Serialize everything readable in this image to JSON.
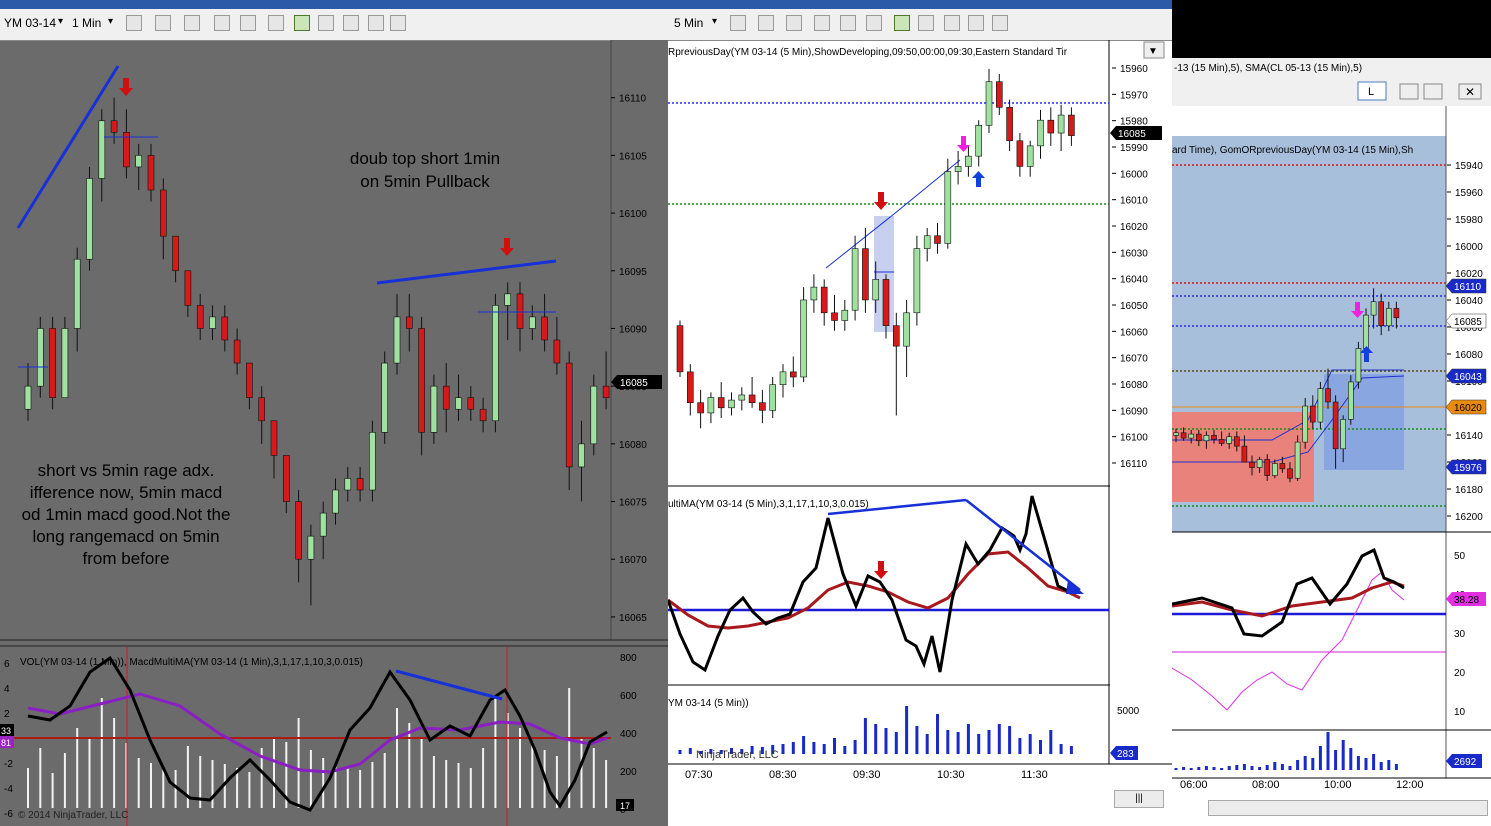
{
  "left_window": {
    "instrument": "YM 03-14",
    "interval": "1 Min",
    "y_ticks": [
      "16110",
      "16105",
      "16100",
      "16095",
      "16090",
      "16085",
      "16080",
      "16075",
      "16070",
      "16065"
    ],
    "last_price": "16085",
    "annotation_top_lines": [
      "doub top short 1min",
      "on 5min Pullback"
    ],
    "annotation_bottom_lines": [
      "short vs  5min rage adx.",
      "ifference now, 5min macd",
      "od 1min macd good.Not the",
      "long rangemacd on 5min",
      "from before"
    ],
    "indicator_label": "VOL(YM 03-14 (1 Min)), MacdMultiMA(YM 03-14 (1 Min),3,1,17,1,10,3,0.015)",
    "vol_ticks": [
      "800",
      "600",
      "400",
      "200",
      "0"
    ],
    "macd_ticks": [
      "6",
      "4",
      "2",
      "0",
      "-2",
      "-4",
      "-6"
    ],
    "marker_top": "33",
    "marker_bottom": "81",
    "vol_marker": "17",
    "copyright": "© 2014 NinjaTrader, LLC"
  },
  "mid_window": {
    "interval": "5 Min",
    "header": "RpreviousDay(YM 03-14 (5 Min),ShowDeveloping,09:50,00:00,09:30,Eastern Standard Tir",
    "y_ticks": [
      "16110",
      "16100",
      "16090",
      "16080",
      "16070",
      "16060",
      "16050",
      "16040",
      "16030",
      "16020",
      "16010",
      "16000",
      "15990",
      "15980",
      "15970",
      "15960"
    ],
    "last_price": "16085",
    "indicator_label": "ultiMA(YM 03-14 (5 Min),3,1,17,1,10,3,0.015)",
    "vol_label": "YM 03-14 (5 Min))",
    "vol_tick": "5000",
    "vol_marker": "283",
    "watermark": "NinjaTrader, LLC",
    "x_ticks": [
      "07:30",
      "08:30",
      "09:30",
      "10:30",
      "11:30"
    ]
  },
  "right_window": {
    "header_top": "-13 (15 Min),5), SMA(CL 05-13 (15 Min),5)",
    "header": "ard Time), GomORpreviousDay(YM 03-14 (15 Min),Sh",
    "tab_label": "L",
    "y_ticks": [
      "16200",
      "16180",
      "16160",
      "16140",
      "16120",
      "16100",
      "16080",
      "16060",
      "16040",
      "16020",
      "16000",
      "15980",
      "15960",
      "15940"
    ],
    "markers": {
      "m16110": "16110",
      "m16085": "16085",
      "m16043": "16043",
      "m16020": "16020",
      "m15976": "15976"
    },
    "ind_ticks": [
      "50",
      "40",
      "30",
      "20",
      "10"
    ],
    "ind_marker": "38.28",
    "vol_marker": "2692",
    "x_ticks": [
      "06:00",
      "08:00",
      "10:00",
      "12:00"
    ]
  },
  "chart_data": [
    {
      "type": "candlestick",
      "instrument": "YM 03-14",
      "interval": "1 Min",
      "ylim": [
        16063,
        16115
      ],
      "ohlc": [
        [
          16083,
          16087,
          16082,
          16085
        ],
        [
          16085,
          16091,
          16084,
          16090
        ],
        [
          16090,
          16091,
          16083,
          16084
        ],
        [
          16084,
          16091,
          16084,
          16090
        ],
        [
          16090,
          16097,
          16088,
          16096
        ],
        [
          16096,
          16104,
          16095,
          16103
        ],
        [
          16103,
          16109,
          16101,
          16108
        ],
        [
          16108,
          16110,
          16106,
          16107
        ],
        [
          16107,
          16109,
          16103,
          16104
        ],
        [
          16104,
          16106,
          16102,
          16105
        ],
        [
          16105,
          16106,
          16101,
          16102
        ],
        [
          16102,
          16103,
          16096,
          16098
        ],
        [
          16098,
          16098,
          16094,
          16095
        ],
        [
          16095,
          16095,
          16091,
          16092
        ],
        [
          16092,
          16093,
          16089,
          16090
        ],
        [
          16090,
          16092,
          16089,
          16091
        ],
        [
          16091,
          16092,
          16088,
          16089
        ],
        [
          16089,
          16090,
          16086,
          16087
        ],
        [
          16087,
          16087,
          16083,
          16084
        ],
        [
          16084,
          16085,
          16080,
          16082
        ],
        [
          16082,
          16082,
          16077,
          16079
        ],
        [
          16079,
          16079,
          16074,
          16075
        ],
        [
          16075,
          16076,
          16068,
          16070
        ],
        [
          16070,
          16073,
          16066,
          16072
        ],
        [
          16072,
          16075,
          16070,
          16074
        ],
        [
          16074,
          16077,
          16073,
          16076
        ],
        [
          16076,
          16078,
          16075,
          16077
        ],
        [
          16077,
          16078,
          16075,
          16076
        ],
        [
          16076,
          16082,
          16075,
          16081
        ],
        [
          16081,
          16088,
          16080,
          16087
        ],
        [
          16087,
          16093,
          16086,
          16091
        ],
        [
          16091,
          16093,
          16088,
          16090
        ],
        [
          16090,
          16091,
          16079,
          16081
        ],
        [
          16081,
          16086,
          16080,
          16085
        ],
        [
          16085,
          16087,
          16081,
          16083
        ],
        [
          16083,
          16086,
          16082,
          16084
        ],
        [
          16084,
          16085,
          16082,
          16083
        ],
        [
          16083,
          16084,
          16081,
          16082
        ],
        [
          16082,
          16093,
          16081,
          16092
        ],
        [
          16092,
          16094,
          16089,
          16093
        ],
        [
          16093,
          16094,
          16088,
          16090
        ],
        [
          16090,
          16092,
          16089,
          16091
        ],
        [
          16091,
          16093,
          16088,
          16089
        ],
        [
          16089,
          16091,
          16086,
          16087
        ],
        [
          16087,
          16088,
          16076,
          16078
        ],
        [
          16078,
          16082,
          16075,
          16080
        ],
        [
          16080,
          16086,
          16079,
          16085
        ],
        [
          16085,
          16088,
          16083,
          16084
        ]
      ]
    },
    {
      "type": "candlestick",
      "instrument": "YM 03-14",
      "interval": "5 Min",
      "ylim": [
        15953,
        16115
      ],
      "ohlc": [
        [
          16010,
          16012,
          15990,
          15992
        ],
        [
          15992,
          15995,
          15975,
          15980
        ],
        [
          15980,
          15985,
          15970,
          15976
        ],
        [
          15976,
          15984,
          15972,
          15982
        ],
        [
          15982,
          15988,
          15974,
          15978
        ],
        [
          15978,
          15984,
          15975,
          15981
        ],
        [
          15981,
          15986,
          15977,
          15983
        ],
        [
          15983,
          15990,
          15978,
          15980
        ],
        [
          15980,
          15985,
          15972,
          15977
        ],
        [
          15977,
          15990,
          15974,
          15987
        ],
        [
          15987,
          15995,
          15982,
          15992
        ],
        [
          15992,
          15998,
          15986,
          15990
        ],
        [
          15990,
          16025,
          15988,
          16020
        ],
        [
          16020,
          16030,
          16015,
          16025
        ],
        [
          16025,
          16028,
          16010,
          16015
        ],
        [
          16015,
          16022,
          16008,
          16012
        ],
        [
          16012,
          16020,
          16008,
          16016
        ],
        [
          16016,
          16045,
          16012,
          16040
        ],
        [
          16040,
          16048,
          16015,
          16020
        ],
        [
          16020,
          16035,
          16015,
          16028
        ],
        [
          16028,
          16030,
          16005,
          16010
        ],
        [
          16010,
          16015,
          15975,
          16002
        ],
        [
          16002,
          16020,
          15990,
          16015
        ],
        [
          16015,
          16045,
          16010,
          16040
        ],
        [
          16040,
          16048,
          16035,
          16045
        ],
        [
          16045,
          16050,
          16038,
          16042
        ],
        [
          16042,
          16075,
          16040,
          16070
        ],
        [
          16070,
          16078,
          16065,
          16072
        ],
        [
          16072,
          16080,
          16068,
          16076
        ],
        [
          16076,
          16090,
          16072,
          16088
        ],
        [
          16088,
          16110,
          16085,
          16105
        ],
        [
          16105,
          16108,
          16092,
          16095
        ],
        [
          16095,
          16098,
          16078,
          16082
        ],
        [
          16082,
          16085,
          16068,
          16072
        ],
        [
          16072,
          16082,
          16068,
          16080
        ],
        [
          16080,
          16094,
          16075,
          16090
        ],
        [
          16090,
          16095,
          16080,
          16085
        ],
        [
          16085,
          16096,
          16078,
          16092
        ],
        [
          16092,
          16095,
          16080,
          16084
        ]
      ]
    },
    {
      "type": "candlestick",
      "instrument": "YM 03-14",
      "interval": "15 Min",
      "ylim": [
        15933,
        16206
      ],
      "ohlc": [
        [
          16000,
          16005,
          15995,
          16002
        ],
        [
          16002,
          16006,
          15996,
          15998
        ],
        [
          15998,
          16004,
          15994,
          16001
        ],
        [
          16001,
          16004,
          15992,
          15996
        ],
        [
          15996,
          16003,
          15990,
          16000
        ],
        [
          16000,
          16004,
          15994,
          15997
        ],
        [
          15997,
          16003,
          15992,
          15994
        ],
        [
          15994,
          16002,
          15990,
          15999
        ],
        [
          15999,
          16003,
          15988,
          15992
        ],
        [
          15992,
          16000,
          15985,
          15980
        ],
        [
          15980,
          15985,
          15970,
          15976
        ],
        [
          15976,
          15984,
          15972,
          15982
        ],
        [
          15982,
          15986,
          15966,
          15970
        ],
        [
          15970,
          15982,
          15968,
          15979
        ],
        [
          15979,
          15984,
          15972,
          15975
        ],
        [
          15975,
          15980,
          15965,
          15968
        ],
        [
          15968,
          16000,
          15966,
          15995
        ],
        [
          15995,
          16028,
          15990,
          16022
        ],
        [
          16022,
          16030,
          16005,
          16010
        ],
        [
          16010,
          16040,
          16005,
          16035
        ],
        [
          16035,
          16050,
          16020,
          16025
        ],
        [
          16025,
          16030,
          15975,
          15990
        ],
        [
          15990,
          16015,
          15980,
          16012
        ],
        [
          16012,
          16045,
          16008,
          16040
        ],
        [
          16040,
          16070,
          16035,
          16065
        ],
        [
          16065,
          16095,
          16060,
          16090
        ],
        [
          16090,
          16110,
          16080,
          16100
        ],
        [
          16100,
          16106,
          16075,
          16082
        ],
        [
          16082,
          16100,
          16078,
          16095
        ],
        [
          16095,
          16100,
          16080,
          16088
        ]
      ]
    }
  ]
}
